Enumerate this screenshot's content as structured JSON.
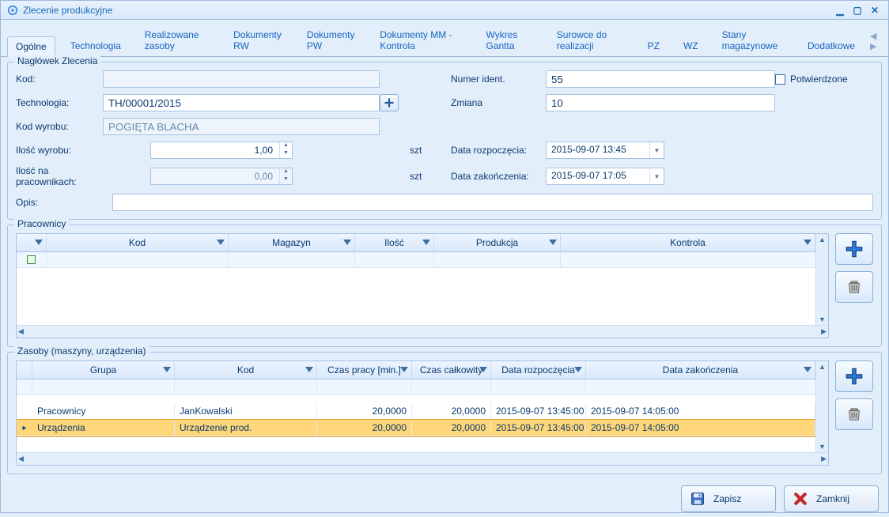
{
  "window": {
    "title": "Zlecenie produkcyjne"
  },
  "tabs": [
    "Ogólne",
    "Technologia",
    "Realizowane zasoby",
    "Dokumenty RW",
    "Dokumenty PW",
    "Dokumenty MM - Kontrola",
    "Wykres Gantta",
    "Surowce do realizacji",
    "PZ",
    "WZ",
    "Stany magazynowe",
    "Dodatkowe"
  ],
  "header": {
    "legend": "Nagłówek Zlecenia",
    "labels": {
      "kod": "Kod:",
      "technologia": "Technologia:",
      "kod_wyrobu": "Kod wyrobu:",
      "ilosc_wyrobu": "Ilość wyrobu:",
      "ilosc_prac": "Ilość na pracownikach:",
      "numer_ident": "Numer ident.",
      "zmiana": "Zmiana",
      "data_rozp": "Data rozpoczęcia:",
      "data_zak": "Data zakończenia:",
      "opis": "Opis:",
      "potwierdzone": "Potwierdzone",
      "unit": "szt"
    },
    "values": {
      "kod": "",
      "technologia": "TH/00001/2015",
      "kod_wyrobu": "POGIĘTA BLACHA",
      "ilosc_wyrobu": "1,00",
      "ilosc_prac": "0,00",
      "numer_ident": "55",
      "zmiana": "10",
      "data_rozp": "2015-09-07 13:45",
      "data_zak": "2015-09-07 17:05",
      "opis": ""
    }
  },
  "pracownicy": {
    "legend": "Pracownicy",
    "columns": [
      "",
      "Kod",
      "Magazyn",
      "Ilość",
      "Produkcja",
      "Kontrola"
    ]
  },
  "zasoby": {
    "legend": "Zasoby (maszyny, urządzenia)",
    "columns": [
      "Grupa",
      "Kod",
      "Czas pracy [min.]",
      "Czas całkowity",
      "Data rozpoczęcia",
      "Data zakończenia"
    ],
    "rows": [
      {
        "grupa": "Pracownicy",
        "kod": "JanKowalski",
        "czas": "20,0000",
        "calk": "20,0000",
        "rozp": "2015-09-07 13:45:00",
        "zak": "2015-09-07 14:05:00",
        "selected": false
      },
      {
        "grupa": "Urządzenia",
        "kod": "Urządzenie prod.",
        "czas": "20,0000",
        "calk": "20,0000",
        "rozp": "2015-09-07 13:45:00",
        "zak": "2015-09-07 14:05:00",
        "selected": true
      }
    ]
  },
  "footer": {
    "save": "Zapisz",
    "close": "Zamknij"
  }
}
